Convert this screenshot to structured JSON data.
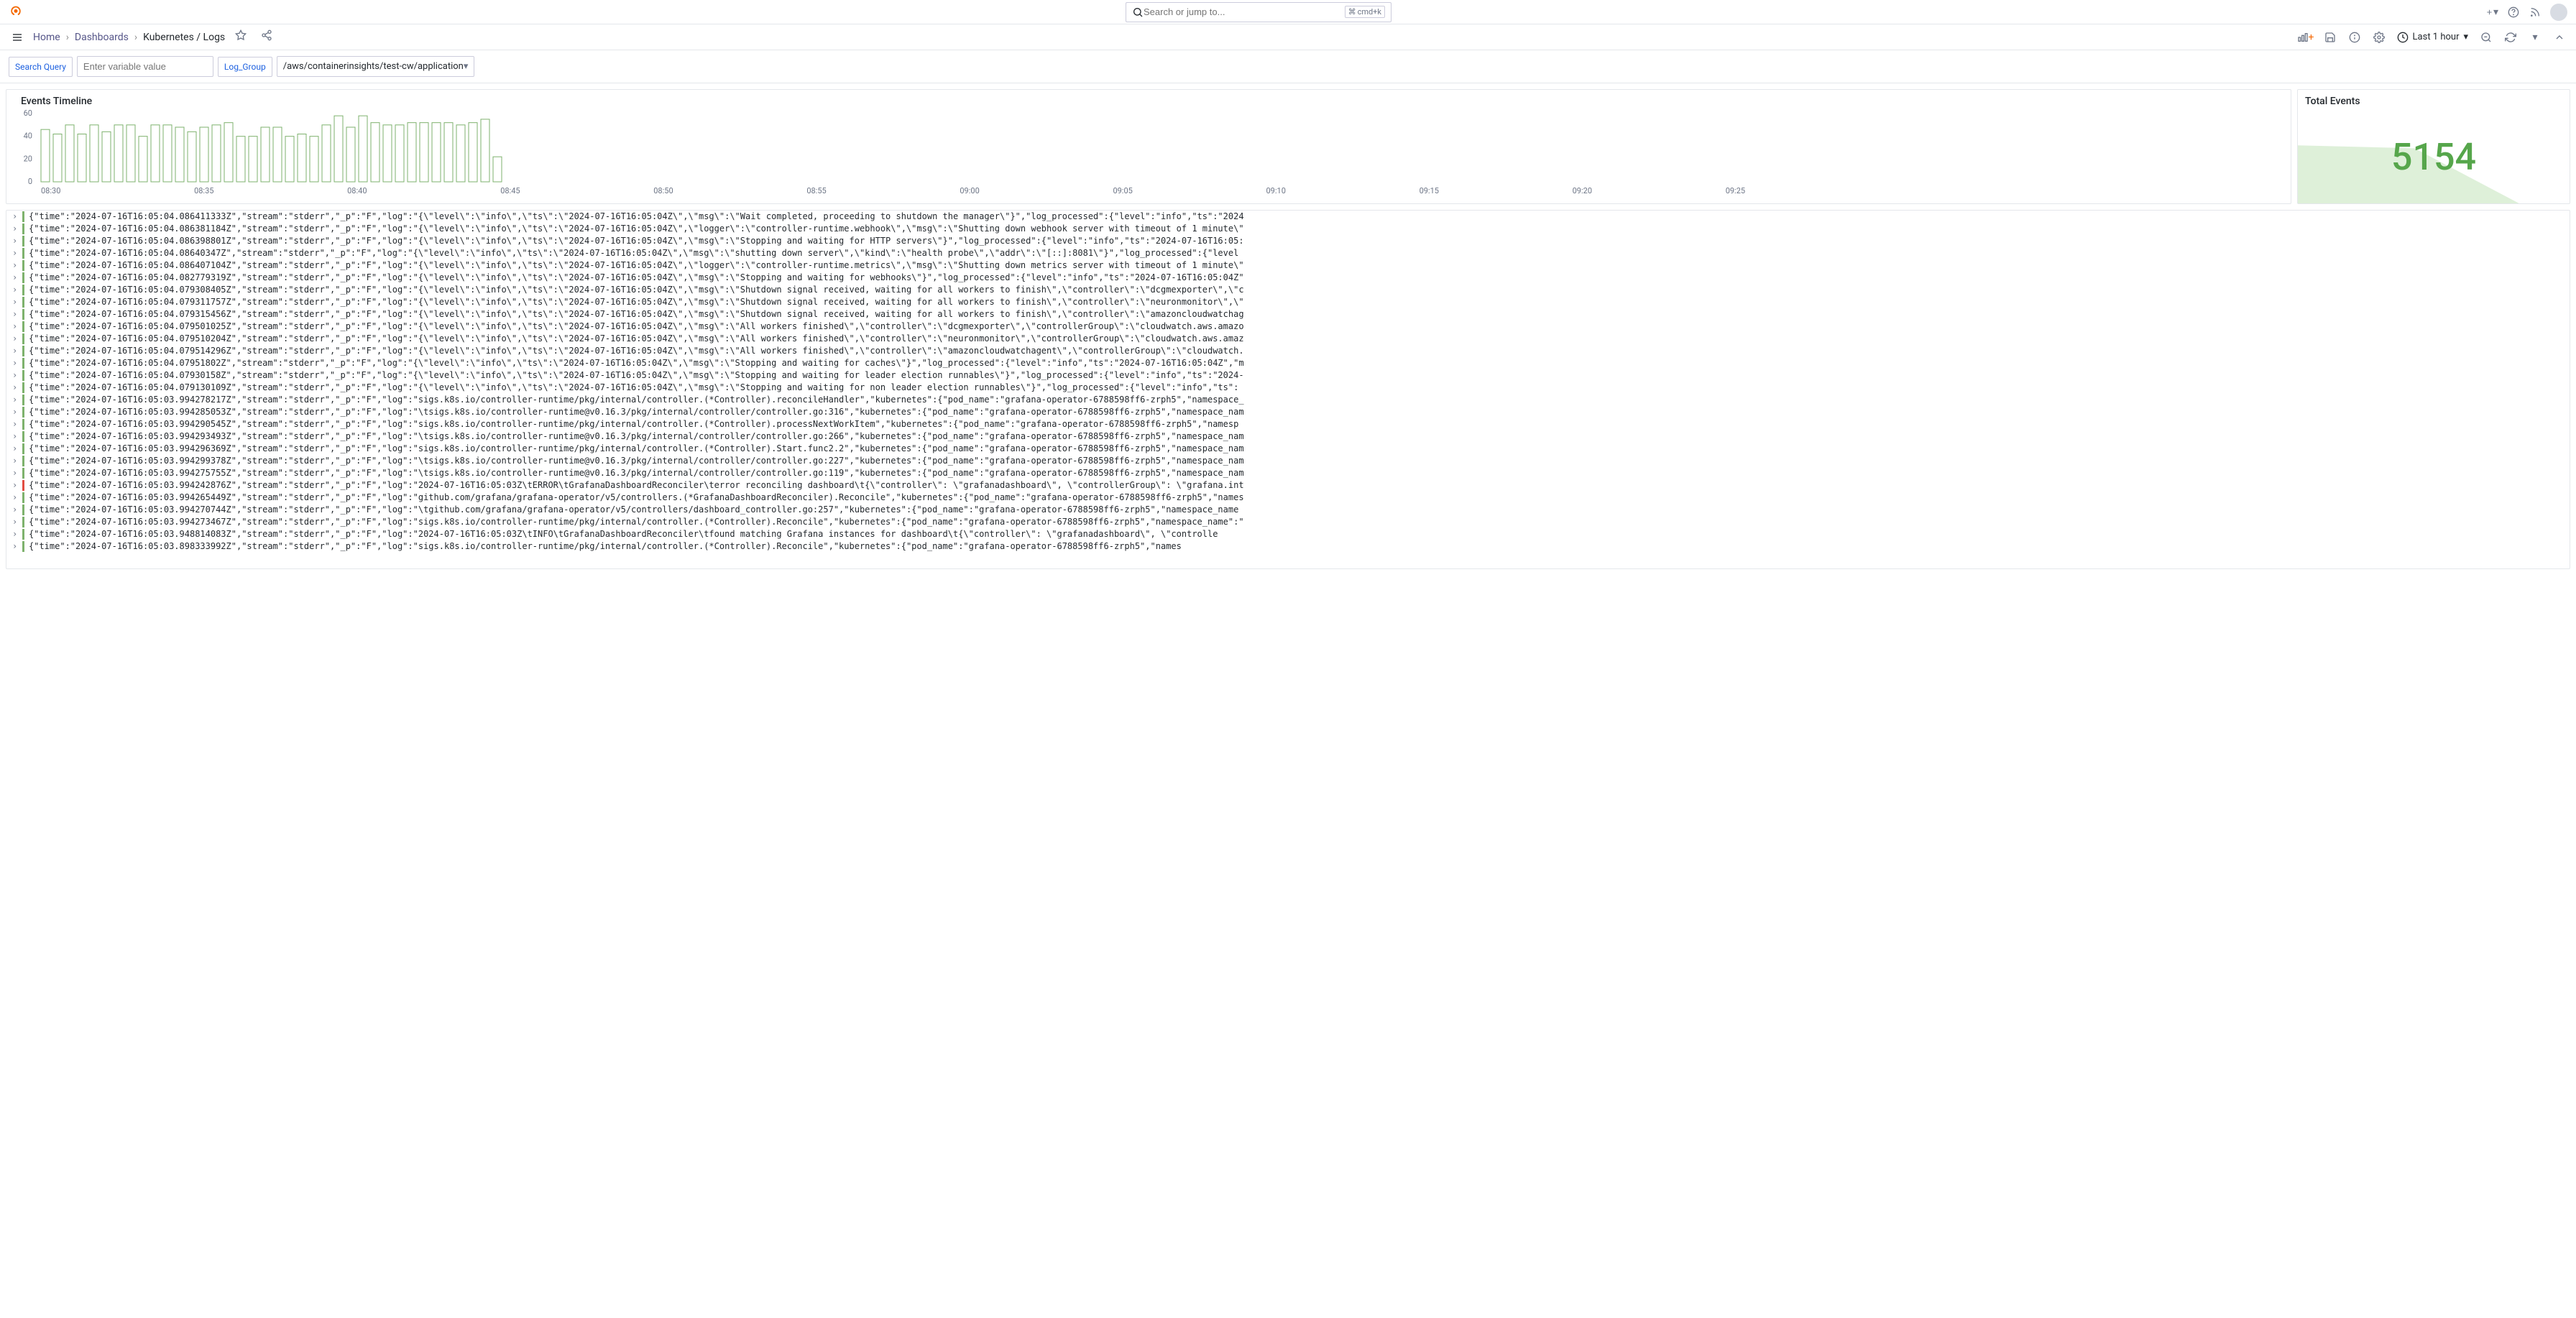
{
  "search": {
    "placeholder": "Search or jump to...",
    "kbd": "cmd+k"
  },
  "breadcrumbs": {
    "home": "Home",
    "dashboards": "Dashboards",
    "current": "Kubernetes / Logs"
  },
  "time_picker": "Last 1 hour",
  "vars": {
    "search_label": "Search Query",
    "search_placeholder": "Enter variable value",
    "log_group_label": "Log_Group",
    "log_group_value": "/aws/containerinsights/test-cw/application"
  },
  "panels": {
    "timeline_title": "Events Timeline",
    "total_title": "Total Events",
    "total_value": "5154"
  },
  "chart_data": {
    "type": "bar",
    "ylim": [
      0,
      60
    ],
    "yticks": [
      0,
      20,
      40,
      60
    ],
    "xticks": [
      "08:30",
      "08:35",
      "08:40",
      "08:45",
      "08:50",
      "08:55",
      "09:00",
      "09:05",
      "09:10",
      "09:15",
      "09:20",
      "09:25"
    ],
    "values": [
      46,
      42,
      50,
      42,
      50,
      44,
      50,
      50,
      40,
      50,
      50,
      48,
      44,
      48,
      50,
      52,
      40,
      40,
      48,
      48,
      40,
      42,
      40,
      50,
      58,
      48,
      58,
      52,
      50,
      50,
      52,
      52,
      52,
      52,
      50,
      52,
      55,
      22
    ]
  },
  "logs": [
    {
      "level": "info",
      "text": "{\"time\":\"2024-07-16T16:05:04.086411333Z\",\"stream\":\"stderr\",\"_p\":\"F\",\"log\":\"{\\\"level\\\":\\\"info\\\",\\\"ts\\\":\\\"2024-07-16T16:05:04Z\\\",\\\"msg\\\":\\\"Wait completed, proceeding to shutdown the manager\\\"}\",\"log_processed\":{\"level\":\"info\",\"ts\":\"2024"
    },
    {
      "level": "info",
      "text": "{\"time\":\"2024-07-16T16:05:04.086381184Z\",\"stream\":\"stderr\",\"_p\":\"F\",\"log\":\"{\\\"level\\\":\\\"info\\\",\\\"ts\\\":\\\"2024-07-16T16:05:04Z\\\",\\\"logger\\\":\\\"controller-runtime.webhook\\\",\\\"msg\\\":\\\"Shutting down webhook server with timeout of 1 minute\\\""
    },
    {
      "level": "info",
      "text": "{\"time\":\"2024-07-16T16:05:04.086398801Z\",\"stream\":\"stderr\",\"_p\":\"F\",\"log\":\"{\\\"level\\\":\\\"info\\\",\\\"ts\\\":\\\"2024-07-16T16:05:04Z\\\",\\\"msg\\\":\\\"Stopping and waiting for HTTP servers\\\"}\",\"log_processed\":{\"level\":\"info\",\"ts\":\"2024-07-16T16:05:"
    },
    {
      "level": "info",
      "text": "{\"time\":\"2024-07-16T16:05:04.08640347Z\",\"stream\":\"stderr\",\"_p\":\"F\",\"log\":\"{\\\"level\\\":\\\"info\\\",\\\"ts\\\":\\\"2024-07-16T16:05:04Z\\\",\\\"msg\\\":\\\"shutting down server\\\",\\\"kind\\\":\\\"health probe\\\",\\\"addr\\\":\\\"[::]:8081\\\"}\",\"log_processed\":{\"level"
    },
    {
      "level": "info",
      "text": "{\"time\":\"2024-07-16T16:05:04.086407104Z\",\"stream\":\"stderr\",\"_p\":\"F\",\"log\":\"{\\\"level\\\":\\\"info\\\",\\\"ts\\\":\\\"2024-07-16T16:05:04Z\\\",\\\"logger\\\":\\\"controller-runtime.metrics\\\",\\\"msg\\\":\\\"Shutting down metrics server with timeout of 1 minute\\\""
    },
    {
      "level": "info",
      "text": "{\"time\":\"2024-07-16T16:05:04.082779319Z\",\"stream\":\"stderr\",\"_p\":\"F\",\"log\":\"{\\\"level\\\":\\\"info\\\",\\\"ts\\\":\\\"2024-07-16T16:05:04Z\\\",\\\"msg\\\":\\\"Stopping and waiting for webhooks\\\"}\",\"log_processed\":{\"level\":\"info\",\"ts\":\"2024-07-16T16:05:04Z\""
    },
    {
      "level": "info",
      "text": "{\"time\":\"2024-07-16T16:05:04.079308405Z\",\"stream\":\"stderr\",\"_p\":\"F\",\"log\":\"{\\\"level\\\":\\\"info\\\",\\\"ts\\\":\\\"2024-07-16T16:05:04Z\\\",\\\"msg\\\":\\\"Shutdown signal received, waiting for all workers to finish\\\",\\\"controller\\\":\\\"dcgmexporter\\\",\\\"c"
    },
    {
      "level": "info",
      "text": "{\"time\":\"2024-07-16T16:05:04.079311757Z\",\"stream\":\"stderr\",\"_p\":\"F\",\"log\":\"{\\\"level\\\":\\\"info\\\",\\\"ts\\\":\\\"2024-07-16T16:05:04Z\\\",\\\"msg\\\":\\\"Shutdown signal received, waiting for all workers to finish\\\",\\\"controller\\\":\\\"neuronmonitor\\\",\\\""
    },
    {
      "level": "info",
      "text": "{\"time\":\"2024-07-16T16:05:04.079315456Z\",\"stream\":\"stderr\",\"_p\":\"F\",\"log\":\"{\\\"level\\\":\\\"info\\\",\\\"ts\\\":\\\"2024-07-16T16:05:04Z\\\",\\\"msg\\\":\\\"Shutdown signal received, waiting for all workers to finish\\\",\\\"controller\\\":\\\"amazoncloudwatchag"
    },
    {
      "level": "info",
      "text": "{\"time\":\"2024-07-16T16:05:04.079501025Z\",\"stream\":\"stderr\",\"_p\":\"F\",\"log\":\"{\\\"level\\\":\\\"info\\\",\\\"ts\\\":\\\"2024-07-16T16:05:04Z\\\",\\\"msg\\\":\\\"All workers finished\\\",\\\"controller\\\":\\\"dcgmexporter\\\",\\\"controllerGroup\\\":\\\"cloudwatch.aws.amazo"
    },
    {
      "level": "info",
      "text": "{\"time\":\"2024-07-16T16:05:04.079510204Z\",\"stream\":\"stderr\",\"_p\":\"F\",\"log\":\"{\\\"level\\\":\\\"info\\\",\\\"ts\\\":\\\"2024-07-16T16:05:04Z\\\",\\\"msg\\\":\\\"All workers finished\\\",\\\"controller\\\":\\\"neuronmonitor\\\",\\\"controllerGroup\\\":\\\"cloudwatch.aws.amaz"
    },
    {
      "level": "info",
      "text": "{\"time\":\"2024-07-16T16:05:04.079514296Z\",\"stream\":\"stderr\",\"_p\":\"F\",\"log\":\"{\\\"level\\\":\\\"info\\\",\\\"ts\\\":\\\"2024-07-16T16:05:04Z\\\",\\\"msg\\\":\\\"All workers finished\\\",\\\"controller\\\":\\\"amazoncloudwatchagent\\\",\\\"controllerGroup\\\":\\\"cloudwatch."
    },
    {
      "level": "info",
      "text": "{\"time\":\"2024-07-16T16:05:04.07951802Z\",\"stream\":\"stderr\",\"_p\":\"F\",\"log\":\"{\\\"level\\\":\\\"info\\\",\\\"ts\\\":\\\"2024-07-16T16:05:04Z\\\",\\\"msg\\\":\\\"Stopping and waiting for caches\\\"}\",\"log_processed\":{\"level\":\"info\",\"ts\":\"2024-07-16T16:05:04Z\",\"m"
    },
    {
      "level": "info",
      "text": "{\"time\":\"2024-07-16T16:05:04.07930158Z\",\"stream\":\"stderr\",\"_p\":\"F\",\"log\":\"{\\\"level\\\":\\\"info\\\",\\\"ts\\\":\\\"2024-07-16T16:05:04Z\\\",\\\"msg\\\":\\\"Stopping and waiting for leader election runnables\\\"}\",\"log_processed\":{\"level\":\"info\",\"ts\":\"2024-"
    },
    {
      "level": "info",
      "text": "{\"time\":\"2024-07-16T16:05:04.079130109Z\",\"stream\":\"stderr\",\"_p\":\"F\",\"log\":\"{\\\"level\\\":\\\"info\\\",\\\"ts\\\":\\\"2024-07-16T16:05:04Z\\\",\\\"msg\\\":\\\"Stopping and waiting for non leader election runnables\\\"}\",\"log_processed\":{\"level\":\"info\",\"ts\":"
    },
    {
      "level": "info",
      "text": "{\"time\":\"2024-07-16T16:05:03.994278217Z\",\"stream\":\"stderr\",\"_p\":\"F\",\"log\":\"sigs.k8s.io/controller-runtime/pkg/internal/controller.(*Controller).reconcileHandler\",\"kubernetes\":{\"pod_name\":\"grafana-operator-6788598ff6-zrph5\",\"namespace_"
    },
    {
      "level": "info",
      "text": "{\"time\":\"2024-07-16T16:05:03.994285053Z\",\"stream\":\"stderr\",\"_p\":\"F\",\"log\":\"\\tsigs.k8s.io/controller-runtime@v0.16.3/pkg/internal/controller/controller.go:316\",\"kubernetes\":{\"pod_name\":\"grafana-operator-6788598ff6-zrph5\",\"namespace_nam"
    },
    {
      "level": "info",
      "text": "{\"time\":\"2024-07-16T16:05:03.994290545Z\",\"stream\":\"stderr\",\"_p\":\"F\",\"log\":\"sigs.k8s.io/controller-runtime/pkg/internal/controller.(*Controller).processNextWorkItem\",\"kubernetes\":{\"pod_name\":\"grafana-operator-6788598ff6-zrph5\",\"namesp"
    },
    {
      "level": "info",
      "text": "{\"time\":\"2024-07-16T16:05:03.994293493Z\",\"stream\":\"stderr\",\"_p\":\"F\",\"log\":\"\\tsigs.k8s.io/controller-runtime@v0.16.3/pkg/internal/controller/controller.go:266\",\"kubernetes\":{\"pod_name\":\"grafana-operator-6788598ff6-zrph5\",\"namespace_nam"
    },
    {
      "level": "info",
      "text": "{\"time\":\"2024-07-16T16:05:03.994296369Z\",\"stream\":\"stderr\",\"_p\":\"F\",\"log\":\"sigs.k8s.io/controller-runtime/pkg/internal/controller.(*Controller).Start.func2.2\",\"kubernetes\":{\"pod_name\":\"grafana-operator-6788598ff6-zrph5\",\"namespace_nam"
    },
    {
      "level": "info",
      "text": "{\"time\":\"2024-07-16T16:05:03.994299378Z\",\"stream\":\"stderr\",\"_p\":\"F\",\"log\":\"\\tsigs.k8s.io/controller-runtime@v0.16.3/pkg/internal/controller/controller.go:227\",\"kubernetes\":{\"pod_name\":\"grafana-operator-6788598ff6-zrph5\",\"namespace_nam"
    },
    {
      "level": "info",
      "text": "{\"time\":\"2024-07-16T16:05:03.994275755Z\",\"stream\":\"stderr\",\"_p\":\"F\",\"log\":\"\\tsigs.k8s.io/controller-runtime@v0.16.3/pkg/internal/controller/controller.go:119\",\"kubernetes\":{\"pod_name\":\"grafana-operator-6788598ff6-zrph5\",\"namespace_nam"
    },
    {
      "level": "error",
      "text": "{\"time\":\"2024-07-16T16:05:03.994242876Z\",\"stream\":\"stderr\",\"_p\":\"F\",\"log\":\"2024-07-16T16:05:03Z\\tERROR\\tGrafanaDashboardReconciler\\terror reconciling dashboard\\t{\\\"controller\\\": \\\"grafanadashboard\\\", \\\"controllerGroup\\\": \\\"grafana.int"
    },
    {
      "level": "info",
      "text": "{\"time\":\"2024-07-16T16:05:03.994265449Z\",\"stream\":\"stderr\",\"_p\":\"F\",\"log\":\"github.com/grafana/grafana-operator/v5/controllers.(*GrafanaDashboardReconciler).Reconcile\",\"kubernetes\":{\"pod_name\":\"grafana-operator-6788598ff6-zrph5\",\"names"
    },
    {
      "level": "info",
      "text": "{\"time\":\"2024-07-16T16:05:03.994270744Z\",\"stream\":\"stderr\",\"_p\":\"F\",\"log\":\"\\tgithub.com/grafana/grafana-operator/v5/controllers/dashboard_controller.go:257\",\"kubernetes\":{\"pod_name\":\"grafana-operator-6788598ff6-zrph5\",\"namespace_name"
    },
    {
      "level": "info",
      "text": "{\"time\":\"2024-07-16T16:05:03.994273467Z\",\"stream\":\"stderr\",\"_p\":\"F\",\"log\":\"sigs.k8s.io/controller-runtime/pkg/internal/controller.(*Controller).Reconcile\",\"kubernetes\":{\"pod_name\":\"grafana-operator-6788598ff6-zrph5\",\"namespace_name\":\""
    },
    {
      "level": "info",
      "text": "{\"time\":\"2024-07-16T16:05:03.948814083Z\",\"stream\":\"stderr\",\"_p\":\"F\",\"log\":\"2024-07-16T16:05:03Z\\tINFO\\tGrafanaDashboardReconciler\\tfound matching Grafana instances for dashboard\\t{\\\"controller\\\": \\\"grafanadashboard\\\", \\\"controlle"
    },
    {
      "level": "info",
      "text": "{\"time\":\"2024-07-16T16:05:03.898333992Z\",\"stream\":\"stderr\",\"_p\":\"F\",\"log\":\"sigs.k8s.io/controller-runtime/pkg/internal/controller.(*Controller).Reconcile\",\"kubernetes\":{\"pod_name\":\"grafana-operator-6788598ff6-zrph5\",\"names"
    }
  ]
}
